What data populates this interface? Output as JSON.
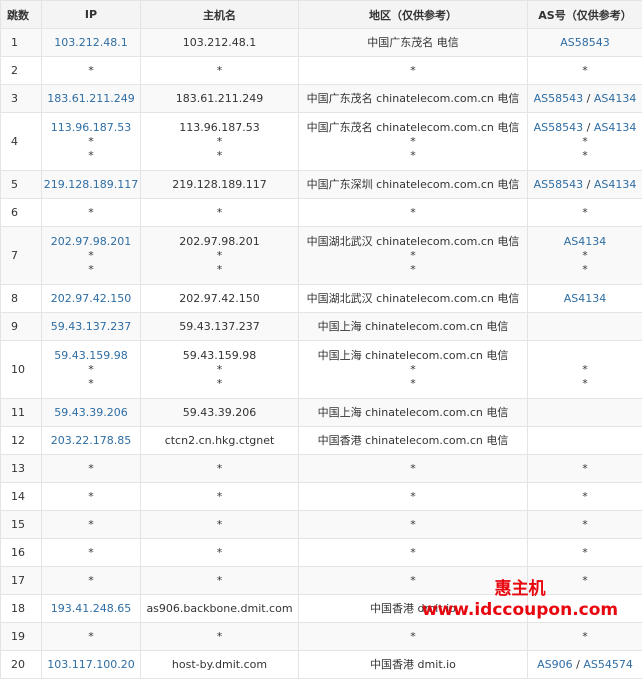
{
  "columns": {
    "hop": "跳数",
    "ip": "IP",
    "host": "主机名",
    "location": "地区（仅供参考）",
    "as": "AS号（仅供参考）"
  },
  "rows": [
    {
      "hop": "1",
      "ip": [
        "103.212.48.1"
      ],
      "host": [
        "103.212.48.1"
      ],
      "loc": [
        "中国广东茂名 电信"
      ],
      "as": [
        [
          "AS58543"
        ]
      ]
    },
    {
      "hop": "2",
      "ip": [
        "*"
      ],
      "host": [
        "*"
      ],
      "loc": [
        "*"
      ],
      "as": [
        [
          "*"
        ]
      ]
    },
    {
      "hop": "3",
      "ip": [
        "183.61.211.249"
      ],
      "host": [
        "183.61.211.249"
      ],
      "loc": [
        "中国广东茂名 chinatelecom.com.cn 电信"
      ],
      "as": [
        [
          "AS58543",
          "AS4134"
        ]
      ]
    },
    {
      "hop": "4",
      "ip": [
        "113.96.187.53",
        "*",
        "*"
      ],
      "host": [
        "113.96.187.53",
        "*",
        "*"
      ],
      "loc": [
        "中国广东茂名 chinatelecom.com.cn 电信",
        "*",
        "*"
      ],
      "as": [
        [
          "AS58543",
          "AS4134"
        ],
        [
          "*"
        ],
        [
          "*"
        ]
      ]
    },
    {
      "hop": "5",
      "ip": [
        "219.128.189.117"
      ],
      "host": [
        "219.128.189.117"
      ],
      "loc": [
        "中国广东深圳 chinatelecom.com.cn 电信"
      ],
      "as": [
        [
          "AS58543",
          "AS4134"
        ]
      ]
    },
    {
      "hop": "6",
      "ip": [
        "*"
      ],
      "host": [
        "*"
      ],
      "loc": [
        "*"
      ],
      "as": [
        [
          "*"
        ]
      ]
    },
    {
      "hop": "7",
      "ip": [
        "202.97.98.201",
        "*",
        "*"
      ],
      "host": [
        "202.97.98.201",
        "*",
        "*"
      ],
      "loc": [
        "中国湖北武汉 chinatelecom.com.cn 电信",
        "*",
        "*"
      ],
      "as": [
        [
          "AS4134"
        ],
        [
          "*"
        ],
        [
          "*"
        ]
      ]
    },
    {
      "hop": "8",
      "ip": [
        "202.97.42.150"
      ],
      "host": [
        "202.97.42.150"
      ],
      "loc": [
        "中国湖北武汉 chinatelecom.com.cn 电信"
      ],
      "as": [
        [
          "AS4134"
        ]
      ]
    },
    {
      "hop": "9",
      "ip": [
        "59.43.137.237"
      ],
      "host": [
        "59.43.137.237"
      ],
      "loc": [
        "中国上海 chinatelecom.com.cn 电信"
      ],
      "as": [
        []
      ]
    },
    {
      "hop": "10",
      "ip": [
        "59.43.159.98",
        "*",
        "*"
      ],
      "host": [
        "59.43.159.98",
        "*",
        "*"
      ],
      "loc": [
        "中国上海 chinatelecom.com.cn 电信",
        "*",
        "*"
      ],
      "as": [
        [],
        [
          "*"
        ],
        [
          "*"
        ]
      ]
    },
    {
      "hop": "11",
      "ip": [
        "59.43.39.206"
      ],
      "host": [
        "59.43.39.206"
      ],
      "loc": [
        "中国上海 chinatelecom.com.cn 电信"
      ],
      "as": [
        []
      ]
    },
    {
      "hop": "12",
      "ip": [
        "203.22.178.85"
      ],
      "host": [
        "ctcn2.cn.hkg.ctgnet"
      ],
      "loc": [
        "中国香港 chinatelecom.com.cn 电信"
      ],
      "as": [
        []
      ]
    },
    {
      "hop": "13",
      "ip": [
        "*"
      ],
      "host": [
        "*"
      ],
      "loc": [
        "*"
      ],
      "as": [
        [
          "*"
        ]
      ]
    },
    {
      "hop": "14",
      "ip": [
        "*"
      ],
      "host": [
        "*"
      ],
      "loc": [
        "*"
      ],
      "as": [
        [
          "*"
        ]
      ]
    },
    {
      "hop": "15",
      "ip": [
        "*"
      ],
      "host": [
        "*"
      ],
      "loc": [
        "*"
      ],
      "as": [
        [
          "*"
        ]
      ]
    },
    {
      "hop": "16",
      "ip": [
        "*"
      ],
      "host": [
        "*"
      ],
      "loc": [
        "*"
      ],
      "as": [
        [
          "*"
        ]
      ]
    },
    {
      "hop": "17",
      "ip": [
        "*"
      ],
      "host": [
        "*"
      ],
      "loc": [
        "*"
      ],
      "as": [
        [
          "*"
        ]
      ]
    },
    {
      "hop": "18",
      "ip": [
        "193.41.248.65"
      ],
      "host": [
        "as906.backbone.dmit.com"
      ],
      "loc": [
        "中国香港 dmit.io"
      ],
      "as": [
        []
      ]
    },
    {
      "hop": "19",
      "ip": [
        "*"
      ],
      "host": [
        "*"
      ],
      "loc": [
        "*"
      ],
      "as": [
        [
          "*"
        ]
      ]
    },
    {
      "hop": "20",
      "ip": [
        "103.117.100.20"
      ],
      "host": [
        "host-by.dmit.com"
      ],
      "loc": [
        "中国香港 dmit.io"
      ],
      "as": [
        [
          "AS906",
          "AS54574"
        ]
      ]
    }
  ],
  "watermark": {
    "line1": "惠主机",
    "line2": "www.idccoupon.com"
  },
  "colors": {
    "link": "#2e6da4",
    "watermark": "#e8060f",
    "header_bg": "#f4f4f4",
    "row_alt_bg": "#f9f9f9",
    "border": "#e4e4e4"
  }
}
